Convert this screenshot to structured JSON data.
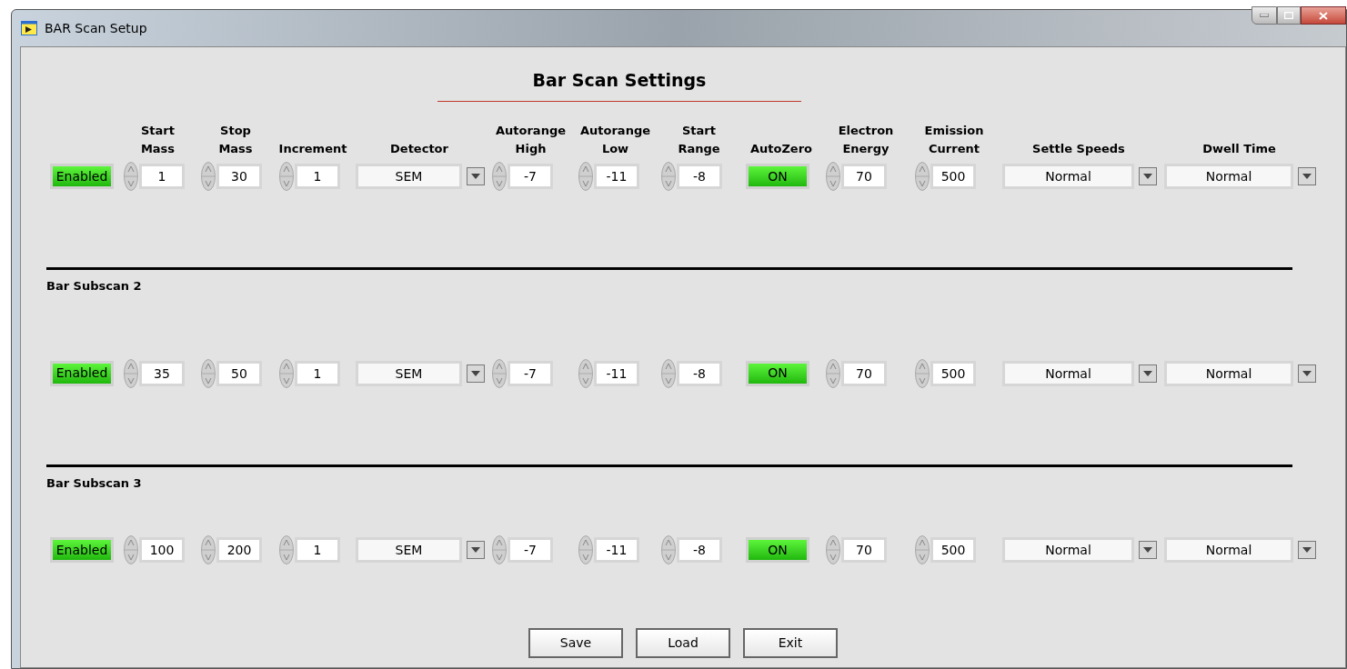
{
  "window": {
    "title": "BAR Scan Setup"
  },
  "heading": "Bar Scan Settings",
  "columns": [
    "Start\nMass",
    "Stop\nMass",
    "Increment",
    "Detector",
    "Autorange\nHigh",
    "Autorange\nLow",
    "Start\nRange",
    "AutoZero",
    "Electron\nEnergy",
    "Emission\nCurrent",
    "Settle Speeds",
    "Dwell Time"
  ],
  "subscans": [
    {
      "controls": [
        {
          "kind": "toggle",
          "text": "Enabled",
          "on": true
        },
        {
          "kind": "spinner",
          "value": "1"
        },
        {
          "kind": "spinner",
          "value": "30"
        },
        {
          "kind": "spinner",
          "value": "1"
        },
        {
          "kind": "dropdown",
          "value": "SEM"
        },
        {
          "kind": "spinner",
          "value": "-7"
        },
        {
          "kind": "spinner",
          "value": "-11"
        },
        {
          "kind": "spinner",
          "value": "-8"
        },
        {
          "kind": "toggle",
          "text": "ON",
          "on": true
        },
        {
          "kind": "spinner",
          "value": "70"
        },
        {
          "kind": "spinner",
          "value": "500"
        },
        {
          "kind": "dropdown",
          "value": "Normal"
        },
        {
          "kind": "dropdown",
          "value": "Normal"
        }
      ]
    },
    {
      "label": "Bar Subscan 2",
      "controls": [
        {
          "kind": "toggle",
          "text": "Enabled",
          "on": true
        },
        {
          "kind": "spinner",
          "value": "35"
        },
        {
          "kind": "spinner",
          "value": "50"
        },
        {
          "kind": "spinner",
          "value": "1"
        },
        {
          "kind": "dropdown",
          "value": "SEM"
        },
        {
          "kind": "spinner",
          "value": "-7"
        },
        {
          "kind": "spinner",
          "value": "-11"
        },
        {
          "kind": "spinner",
          "value": "-8"
        },
        {
          "kind": "toggle",
          "text": "ON",
          "on": true
        },
        {
          "kind": "spinner",
          "value": "70"
        },
        {
          "kind": "spinner",
          "value": "500"
        },
        {
          "kind": "dropdown",
          "value": "Normal"
        },
        {
          "kind": "dropdown",
          "value": "Normal"
        }
      ]
    },
    {
      "label": "Bar Subscan 3",
      "controls": [
        {
          "kind": "toggle",
          "text": "Enabled",
          "on": true
        },
        {
          "kind": "spinner",
          "value": "100"
        },
        {
          "kind": "spinner",
          "value": "200"
        },
        {
          "kind": "spinner",
          "value": "1"
        },
        {
          "kind": "dropdown",
          "value": "SEM"
        },
        {
          "kind": "spinner",
          "value": "-7"
        },
        {
          "kind": "spinner",
          "value": "-11"
        },
        {
          "kind": "spinner",
          "value": "-8"
        },
        {
          "kind": "toggle",
          "text": "ON",
          "on": true
        },
        {
          "kind": "spinner",
          "value": "70"
        },
        {
          "kind": "spinner",
          "value": "500"
        },
        {
          "kind": "dropdown",
          "value": "Normal"
        },
        {
          "kind": "dropdown",
          "value": "Normal"
        }
      ]
    }
  ],
  "buttons": [
    "Save",
    "Load",
    "Exit"
  ]
}
